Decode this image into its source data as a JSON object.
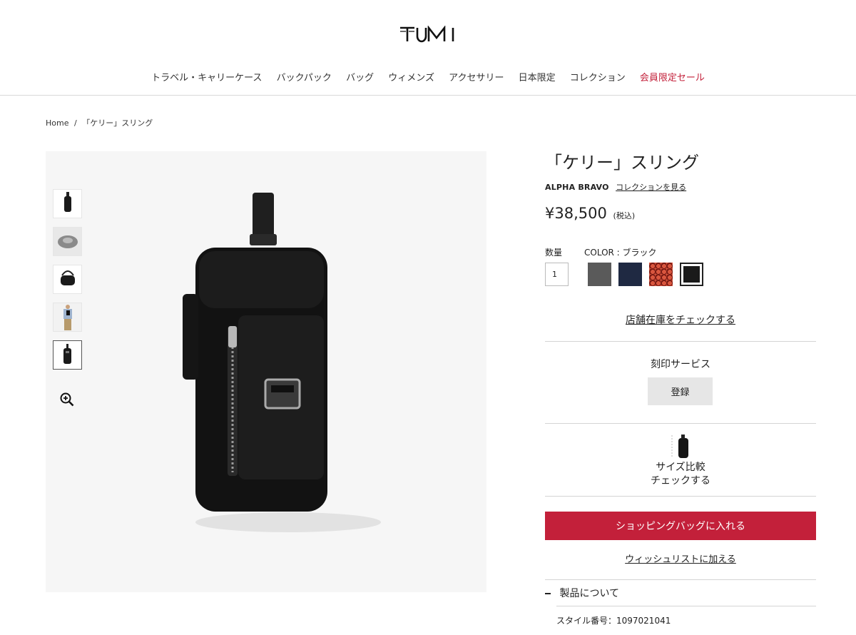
{
  "brand": {
    "logo_text": "TUMI"
  },
  "nav": {
    "items": [
      "トラベル・キャリーケース",
      "バックパック",
      "バッグ",
      "ウィメンズ",
      "アクセサリー",
      "日本限定",
      "コレクション",
      "会員限定セール"
    ]
  },
  "breadcrumb": {
    "home": "Home",
    "separator": "/",
    "current": "「ケリー」スリング"
  },
  "product": {
    "title": "「ケリー」スリング",
    "collection": "ALPHA BRAVO",
    "collection_link": "コレクションを見る",
    "price": "¥38,500",
    "tax_note": "(税込)",
    "quantity_label": "数量",
    "quantity_value": "1",
    "color_label": "COLOR : ブラック",
    "swatches": [
      {
        "name": "grey",
        "color": "#5a5a5a"
      },
      {
        "name": "navy",
        "color": "#1f2942"
      },
      {
        "name": "red-pattern",
        "color": "#a8281f"
      },
      {
        "name": "black",
        "color": "#1a1a1a",
        "selected": true
      }
    ],
    "store_stock_link": "店舗在庫をチェックする",
    "engraving_title": "刻印サービス",
    "engraving_button": "登録",
    "size_compare_line1": "サイズ比較",
    "size_compare_line2": "チェックする",
    "add_to_bag": "ショッピングバッグに入れる",
    "wishlist": "ウィッシュリストに加える",
    "about_label": "製品について",
    "style_number": "スタイル番号：1097021041"
  },
  "colors": {
    "accent": "#c3203a",
    "sale": "#c3203a"
  }
}
